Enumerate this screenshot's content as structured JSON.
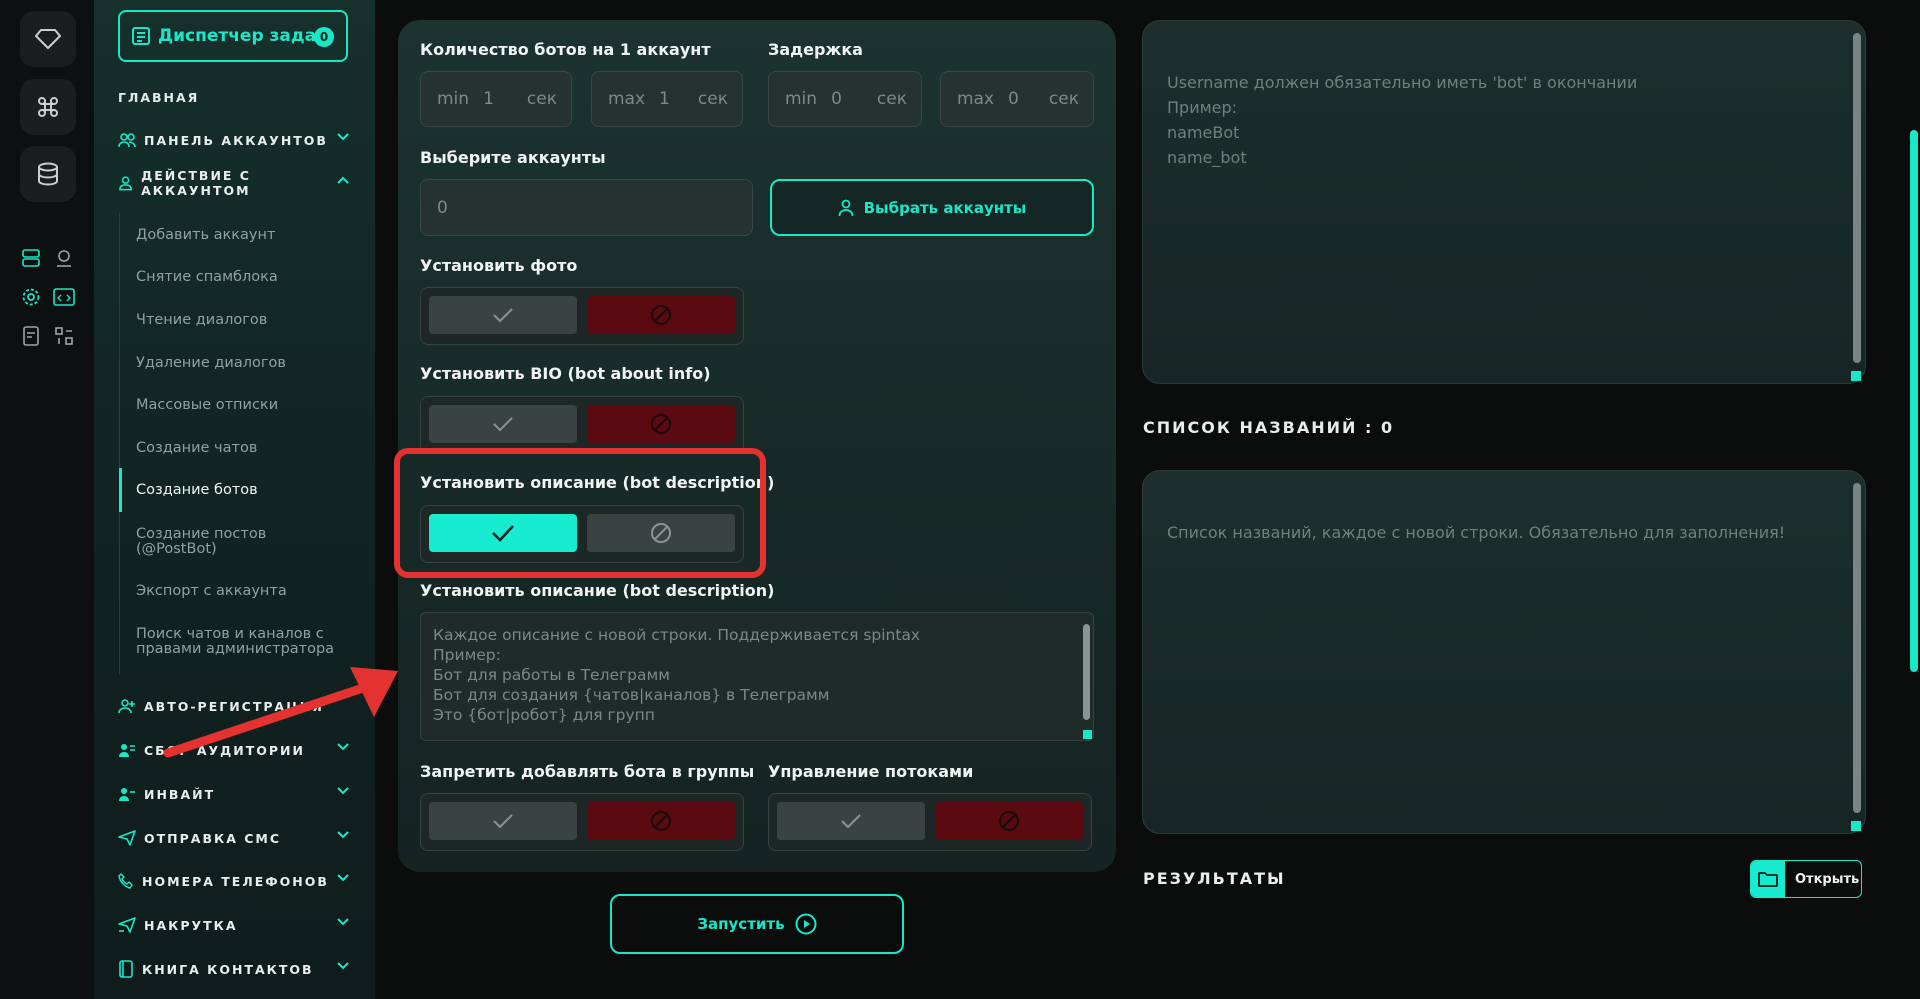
{
  "sidebar": {
    "task_manager": "Диспетчер задач",
    "task_count": "0",
    "main_heading": "ГЛАВНАЯ",
    "sections": {
      "accounts_panel": "ПАНЕЛЬ АККАУНТОВ",
      "account_actions": "ДЕЙСТВИЕ С АККАУНТОМ",
      "auto_registration": "АВТО-РЕГИСТРАЦИЯ",
      "audience_collection": "СБОР АУДИТОРИИ",
      "invite": "ИНВАЙТ",
      "sms_sending": "ОТПРАВКА СМС",
      "phone_numbers": "НОМЕРА ТЕЛЕФОНОВ",
      "boost": "НАКРУТКА",
      "contact_book": "КНИГА КОНТАКТОВ"
    },
    "sub_items": [
      "Добавить аккаунт",
      "Снятие спамблока",
      "Чтение диалогов",
      "Удаление диалогов",
      "Массовые отписки",
      "Создание чатов",
      "Создание ботов",
      "Создание постов\n(@PostBot)",
      "Экспорт с аккаунта",
      "Поиск чатов и каналов с\nправами администратора"
    ],
    "active_item": "Создание ботов"
  },
  "form": {
    "bots_per_account_label": "Количество ботов на 1 аккаунт",
    "delay_label": "Задержка",
    "bots_min": {
      "prefix": "min",
      "value": "1",
      "suffix": "сек"
    },
    "bots_max": {
      "prefix": "max",
      "value": "1",
      "suffix": "сек"
    },
    "delay_min": {
      "prefix": "min",
      "value": "0",
      "suffix": "сек"
    },
    "delay_max": {
      "prefix": "max",
      "value": "0",
      "suffix": "сек"
    },
    "select_accounts_label": "Выберите аккаунты",
    "selected_accounts_value": "0",
    "select_accounts_button": "Выбрать аккаунты",
    "set_photo_label": "Установить фото",
    "set_bio_label": "Установить BIO (bot about info)",
    "set_description_label": "Установить описание (bot description)",
    "description_text_label": "Установить описание (bot description)",
    "description_placeholder": "Каждое описание с новой строки. Поддерживается spintax\nПример:\nБот для работы в Телеграмм\nБот для создания {чатов|каналов} в Телеграмм\nЭто {бот|робот} для групп",
    "forbid_groups_label": "Запретить добавлять бота в группы",
    "threads_label": "Управление потоками",
    "run_button": "Запустить",
    "toggles": {
      "set_photo": false,
      "set_bio": false,
      "set_description": true,
      "forbid_groups": false,
      "threads": false
    }
  },
  "right": {
    "username_hint": "Username должен обязательно иметь 'bot' в окончании\nПример:\nnameBot\nname_bot",
    "names_list_heading": "СПИСОК НАЗВАНИЙ : 0",
    "names_placeholder": "Список названий, каждое с новой строки. Обязательно для заполнения!",
    "results_heading": "РЕЗУЛЬТАТЫ",
    "open_button": "Открыть"
  },
  "colors": {
    "accent": "#18e8c8",
    "reject": "#5b0a12",
    "highlight": "#e3322f"
  }
}
